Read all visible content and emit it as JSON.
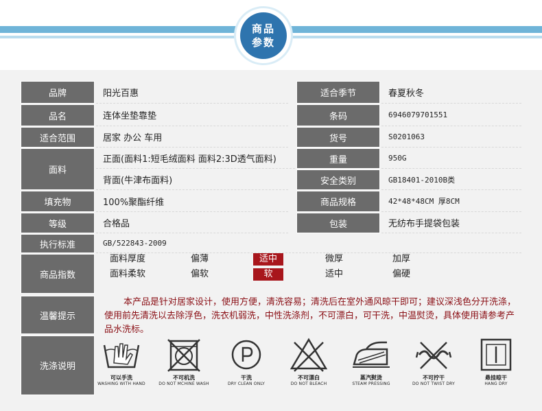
{
  "badge": {
    "line1": "商品",
    "line2": "参数"
  },
  "rows": {
    "brand": {
      "label": "品牌",
      "value": "阳光百惠"
    },
    "name": {
      "label": "品名",
      "value": "连体坐垫靠垫"
    },
    "scope": {
      "label": "适合范围",
      "value": "居家 办公 车用"
    },
    "fabric": {
      "label": "面料",
      "front": "正面(面料1:短毛绒面料 面料2:3D透气面料)",
      "back": "背面(牛津布面料)"
    },
    "filling": {
      "label": "填充物",
      "value": "100%聚酯纤维"
    },
    "grade": {
      "label": "等级",
      "value": "合格品"
    },
    "standard": {
      "label": "执行标准",
      "value": "GB/522843-2009"
    },
    "season": {
      "label": "适合季节",
      "value": "春夏秋冬"
    },
    "barcode": {
      "label": "条码",
      "value": "6946079701551"
    },
    "sku": {
      "label": "货号",
      "value": "S0201063"
    },
    "weight": {
      "label": "重量",
      "value": "950G"
    },
    "safety": {
      "label": "安全类别",
      "value": "GB18401-2010B类"
    },
    "spec": {
      "label": "商品规格",
      "value": "42*48*48CM  厚8CM"
    },
    "package": {
      "label": "包装",
      "value": "无纺布手提袋包装"
    }
  },
  "index": {
    "label": "商品指数",
    "thickness": {
      "name": "面料厚度",
      "options": [
        "偏薄",
        "适中",
        "微厚",
        "加厚"
      ],
      "selected": "适中"
    },
    "softness": {
      "name": "面料柔软",
      "options": [
        "偏软",
        "软",
        "适中",
        "偏硬"
      ],
      "selected": "软"
    }
  },
  "tips": {
    "label": "温馨提示",
    "text": "本产品是针对居家设计，使用方便，清洗容易；清洗后在室外通风晾干即可；建议深浅色分开洗涤，使用前先清洗以去除浮色，洗衣机弱洗，中性洗涤剂，不可漂白，可干洗，中温熨烫，具体使用请参考产品水洗标。"
  },
  "care": {
    "label": "洗涤说明",
    "items": [
      {
        "icon": "hand-wash-icon",
        "zh": "可以手洗",
        "en": "WASHING WITH HAND"
      },
      {
        "icon": "no-machine-wash-icon",
        "zh": "不可机洗",
        "en": "DO NOT MCHINE WASH"
      },
      {
        "icon": "dry-clean-icon",
        "zh": "干洗",
        "en": "DRY CLEAN ONLY"
      },
      {
        "icon": "no-bleach-icon",
        "zh": "不可漂白",
        "en": "DO NOT BLEACH"
      },
      {
        "icon": "steam-iron-icon",
        "zh": "蒸汽熨烫",
        "en": "STEAM PRESSING"
      },
      {
        "icon": "no-wring-icon",
        "zh": "不可拧干",
        "en": "DO NOT TWIST DRY"
      },
      {
        "icon": "hang-dry-icon",
        "zh": "悬挂晾干",
        "en": "HANG DRY"
      }
    ]
  },
  "colors": {
    "label_bg": "#6b6b6b",
    "highlight": "#a8161c",
    "stripe": "#6fb4d8",
    "badge": "#2e74ae",
    "tip_text": "#8a0e14"
  }
}
